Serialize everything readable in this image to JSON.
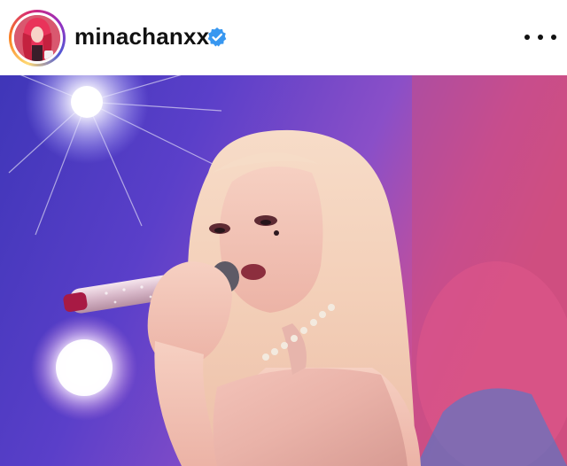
{
  "post": {
    "author": {
      "username": "minachanxx",
      "verified": true,
      "avatar_icon": "profile-avatar"
    },
    "more_icon": "more-options-icon",
    "verified_icon": "verified-badge-icon",
    "photo_icon": "post-photo",
    "colors": {
      "verified_blue": "#3897f0",
      "text": "#111111"
    }
  }
}
